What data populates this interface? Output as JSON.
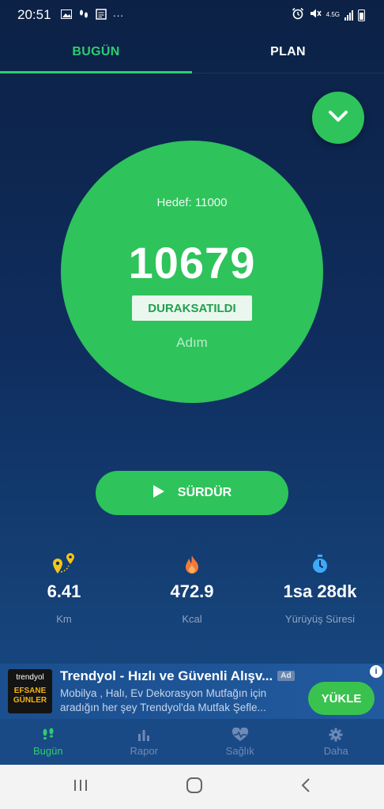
{
  "status_bar": {
    "time": "20:51",
    "dots": "···",
    "network": "4.5G"
  },
  "tabs": [
    {
      "label": "BUGÜN",
      "active": true
    },
    {
      "label": "PLAN",
      "active": false
    }
  ],
  "step_card": {
    "goal_text": "Hedef: 11000",
    "steps": "10679",
    "status_badge": "DURAKSATILDI",
    "unit": "Adım"
  },
  "resume_button": {
    "label": "SÜRDÜR"
  },
  "stats": [
    {
      "icon": "map-pin-icon",
      "value": "6.41",
      "label": "Km",
      "color": "#f5c518"
    },
    {
      "icon": "flame-icon",
      "value": "472.9",
      "label": "Kcal",
      "color": "#f07a3a"
    },
    {
      "icon": "stopwatch-icon",
      "value": "1sa 28dk",
      "label": "Yürüyüş Süresi",
      "color": "#3fa9f5"
    }
  ],
  "ad": {
    "logo_brand": "trendyol",
    "logo_line1": "EFSANE",
    "logo_line2": "GÜNLER",
    "title": "Trendyol - Hızlı ve Güvenli Alışv...",
    "tag": "Ad",
    "description": "Mobilya , Halı, Ev Dekorasyon Mutfağın için aradığın her şey Trendyol'da Mutfak Şefle...",
    "install_label": "YÜKLE",
    "info": "i"
  },
  "bottom_nav": [
    {
      "label": "Bugün",
      "icon": "footsteps-icon",
      "active": true
    },
    {
      "label": "Rapor",
      "icon": "bar-chart-icon",
      "active": false
    },
    {
      "label": "Sağlık",
      "icon": "heart-pulse-icon",
      "active": false
    },
    {
      "label": "Daha",
      "icon": "gear-icon",
      "active": false
    }
  ],
  "colors": {
    "accent": "#2ec35b",
    "background_top": "#0c2145",
    "background_bottom": "#1a4a86"
  }
}
